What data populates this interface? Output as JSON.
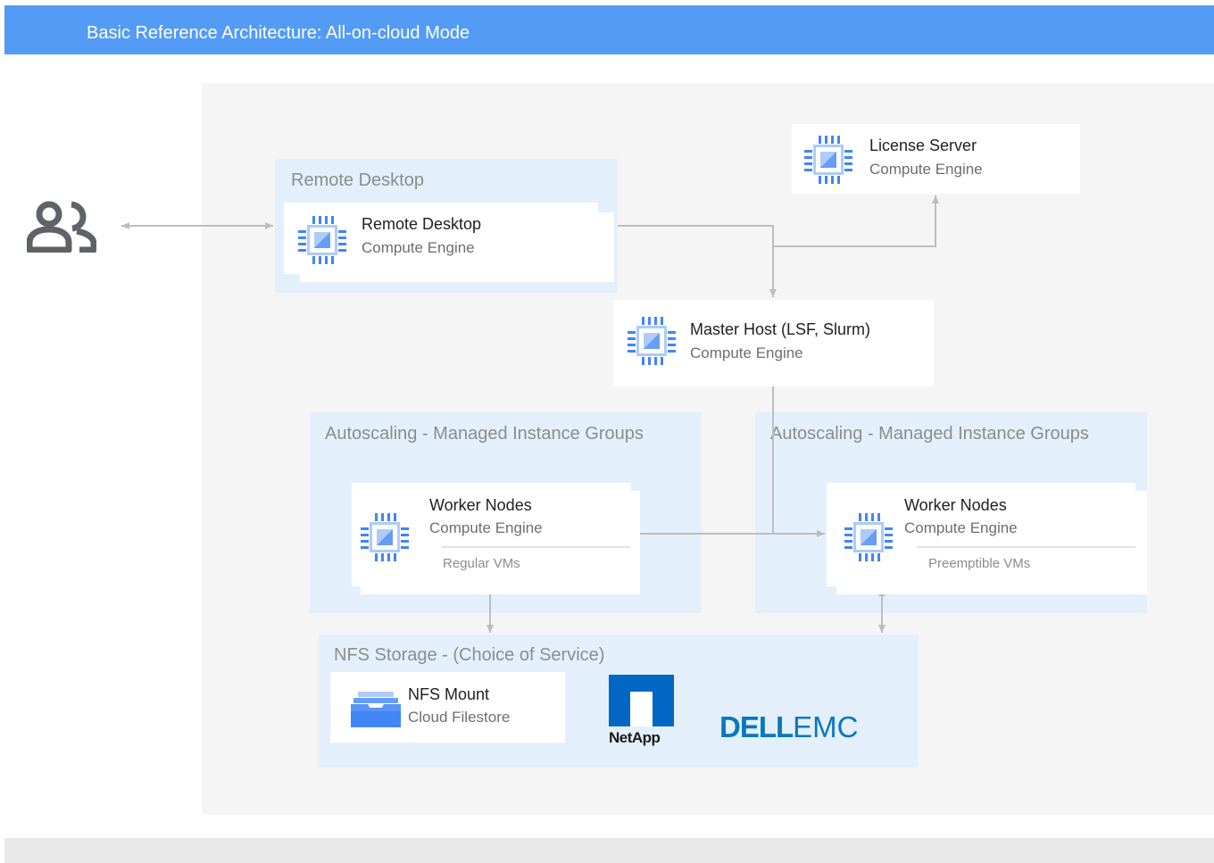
{
  "header": {
    "title": "Basic Reference Architecture: All-on-cloud Mode"
  },
  "icons": {
    "users": "users-icon",
    "compute": "compute-engine-icon",
    "filestore": "cloud-filestore-icon"
  },
  "colors": {
    "header": "#549bf5",
    "zone": "#e3f0fc",
    "canvas": "#f5f5f5",
    "icon_blue": "#4285f4",
    "icon_light": "#aecbfa",
    "connector": "#bdbdbd"
  },
  "zones": {
    "remote_desktop": {
      "label": "Remote Desktop"
    },
    "autoscaling_left": {
      "label": "Autoscaling - Managed Instance Groups"
    },
    "autoscaling_right": {
      "label": "Autoscaling - Managed Instance Groups"
    },
    "nfs_storage": {
      "label": "NFS Storage - (Choice of Service)"
    }
  },
  "nodes": {
    "license_server": {
      "title": "License Server",
      "subtitle": "Compute Engine"
    },
    "remote_desktop": {
      "title": "Remote Desktop",
      "subtitle": "Compute Engine"
    },
    "master_host": {
      "title": "Master Host (LSF, Slurm)",
      "subtitle": "Compute Engine"
    },
    "worker_regular": {
      "title": "Worker Nodes",
      "subtitle": "Compute Engine",
      "note": "Regular VMs"
    },
    "worker_preemptible": {
      "title": "Worker Nodes",
      "subtitle": "Compute Engine",
      "note": "Preemptible VMs"
    },
    "nfs_mount": {
      "title": "NFS Mount",
      "subtitle": "Cloud Filestore"
    }
  },
  "logos": {
    "netapp": "NetApp",
    "dellemc_dell": "DELL",
    "dellemc_emc": "EMC"
  }
}
